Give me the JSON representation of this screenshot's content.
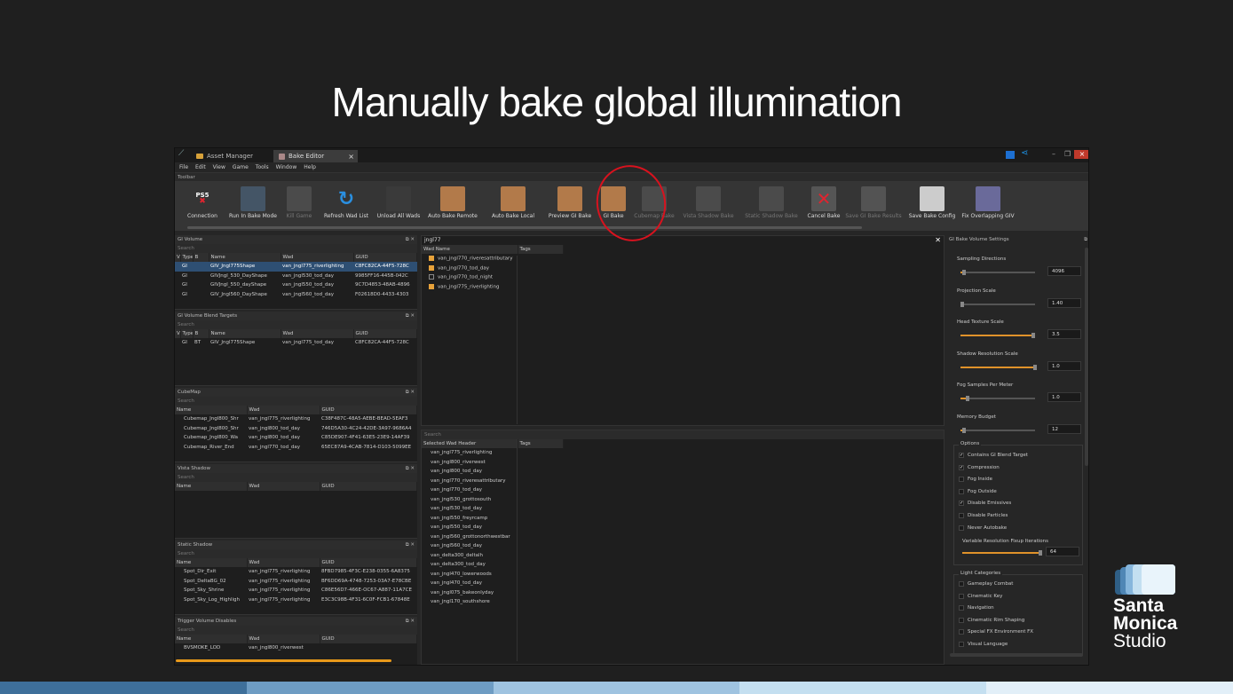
{
  "slide": {
    "title": "Manually bake global illumination"
  },
  "app": {
    "tabs": [
      "Asset Manager",
      "Bake Editor"
    ],
    "menu": [
      "File",
      "Edit",
      "View",
      "Game",
      "Tools",
      "Window",
      "Help"
    ],
    "toolbar_label": "Toolbar",
    "toolbar_buttons": [
      {
        "label": "Connection",
        "icon": "ps5-icon",
        "enabled": true
      },
      {
        "label": "Run In Bake Mode",
        "icon": "run-bake-icon",
        "enabled": true
      },
      {
        "label": "Kill Game",
        "icon": "kill-game-icon",
        "enabled": false
      },
      {
        "label": "Refresh Wad List",
        "icon": "refresh-icon",
        "enabled": true
      },
      {
        "label": "Unload All Wads",
        "icon": "unload-wads-icon",
        "enabled": true
      },
      {
        "label": "Auto Bake Remote",
        "icon": "auto-bake-remote-icon",
        "enabled": true
      },
      {
        "label": "Auto Bake Local",
        "icon": "auto-bake-local-icon",
        "enabled": true
      },
      {
        "label": "Preview GI Bake",
        "icon": "preview-gi-icon",
        "enabled": true
      },
      {
        "label": "GI Bake",
        "icon": "gi-bake-icon",
        "enabled": true
      },
      {
        "label": "Cubemap Bake",
        "icon": "cubemap-bake-icon",
        "enabled": false
      },
      {
        "label": "Vista Shadow Bake",
        "icon": "vista-shadow-icon",
        "enabled": false
      },
      {
        "label": "Static Shadow Bake",
        "icon": "static-shadow-icon",
        "enabled": false
      },
      {
        "label": "Cancel Bake",
        "icon": "cancel-bake-icon",
        "enabled": true
      },
      {
        "label": "Save GI Bake Results",
        "icon": "save-gi-icon",
        "enabled": false
      },
      {
        "label": "Save Bake Config",
        "icon": "save-config-icon",
        "enabled": true
      },
      {
        "label": "Fix Overlapping GIV",
        "icon": "fix-overlap-icon",
        "enabled": true
      }
    ]
  },
  "gi_volume": {
    "title": "GI Volume",
    "search": "Search",
    "headers": [
      "V",
      "Type",
      "B",
      "Name",
      "Wad",
      "GUID"
    ],
    "rows": [
      [
        "",
        "GI",
        "",
        "GIV_Jngl775Shape",
        "van_jngl775_riverlighting",
        "C8FC82CA-44F5-728C"
      ],
      [
        "",
        "GI",
        "",
        "GIVJngl_530_DayShape",
        "van_jngl530_tod_day",
        "9985FF16-445B-042C"
      ],
      [
        "",
        "GI",
        "",
        "GIVJngl_550_dayShape",
        "van_jngl550_tod_day",
        "9C7D4853-48AB-4896"
      ],
      [
        "",
        "GI",
        "",
        "GIV_Jngl560_DayShape",
        "van_jngl560_tod_day",
        "F02618D0-4433-4303"
      ]
    ]
  },
  "gi_blend": {
    "title": "GI Volume Blend Targets",
    "search": "Search",
    "headers": [
      "V",
      "Type",
      "B",
      "Name",
      "Wad",
      "GUID"
    ],
    "rows": [
      [
        "",
        "GI",
        "BT",
        "GIV_Jngl775Shape",
        "van_jngl775_tod_day",
        "C8FC82CA-44F5-728C"
      ]
    ]
  },
  "cubemap": {
    "title": "CubeMap",
    "search": "Search",
    "headers": [
      "Name",
      "Wad",
      "GUID"
    ],
    "rows": [
      [
        "Cubemap_Jngl800_Shr",
        "van_jngl775_riverlighting",
        "C38F487C-48A5-AEBE-BEAD-5EAF3"
      ],
      [
        "Cubemap_Jngl800_Shr",
        "van_jngl800_tod_day",
        "746D5A30-4C24-42DE-3A97-9686A4"
      ],
      [
        "Cubemap_Jngl800_Wa",
        "van_jngl800_tod_day",
        "C85DE907-4F41-63E5-23E9-14AF39"
      ],
      [
        "Cubemap_River_End",
        "van_jngl770_tod_day",
        "65EC87A9-4CAB-7814-D103-5099EE"
      ]
    ]
  },
  "vista_shadow": {
    "title": "Vista Shadow",
    "search": "Search",
    "headers": [
      "Name",
      "Wad",
      "GUID"
    ]
  },
  "static_shadow": {
    "title": "Static Shadow",
    "search": "Search",
    "headers": [
      "Name",
      "Wad",
      "GUID"
    ],
    "rows": [
      [
        "Spot_Dir_Exit",
        "van_jngl775_riverlighting",
        "8FBD7985-4F3C-E238-0355-6A8375"
      ],
      [
        "Spot_DeltaBG_02",
        "van_jngl775_riverlighting",
        "BF6DD69A-4748-7253-03A7-E78CBE"
      ],
      [
        "Spot_Sky_Shrine",
        "van_jngl775_riverlighting",
        "C86E56D7-466E-OC67-A887-11A7CE"
      ],
      [
        "Spot_Sky_Log_Highligh",
        "van_jngl775_riverlighting",
        "E3C3C98B-4F31-6C0F-FCB1-67848E"
      ]
    ]
  },
  "trigger_volume": {
    "title": "Trigger Volume Disables",
    "search": "Search",
    "headers": [
      "Name",
      "Wad",
      "GUID"
    ],
    "rows": [
      [
        "BVSMOKE_LOD",
        "van_jngl800_riverwest",
        ""
      ]
    ]
  },
  "wad_panel": {
    "title": "jngl77",
    "headers": [
      "Wad Name",
      "Tags"
    ],
    "rows": [
      {
        "name": "van_jngl770_riveresattributary",
        "checked": true
      },
      {
        "name": "van_jngl770_tod_day",
        "checked": true
      },
      {
        "name": "van_jngl770_tod_night",
        "checked": false
      },
      {
        "name": "van_jngl775_riverlighting",
        "checked": true
      }
    ]
  },
  "selected_wad": {
    "search": "Search",
    "headers": [
      "Selected Wad Header",
      "Tags"
    ],
    "rows": [
      "van_jngl775_riverlighting",
      "van_jngl800_riverwest",
      "van_jngl800_tod_day",
      "van_jngl770_riveresattributary",
      "van_jngl770_tod_day",
      "van_jngl530_grottosouth",
      "van_jngl530_tod_day",
      "van_jngl550_freyrcamp",
      "van_jngl550_tod_day",
      "van_jngl560_grottonorthwestbar",
      "van_jngl560_tod_day",
      "van_delta300_deltalh",
      "van_delta300_tod_day",
      "van_jngl470_lowerwoods",
      "van_jngl470_tod_day",
      "van_jngl075_bakeonlyday",
      "van_jngl170_southshore"
    ]
  },
  "settings": {
    "title": "GI Bake Volume Settings",
    "fields": [
      {
        "label": "Sampling Directions",
        "value": "4096",
        "level": 0.05
      },
      {
        "label": "Projection Scale",
        "value": "1.40",
        "level": 0.02
      },
      {
        "label": "Head Texture Scale",
        "value": "3.5",
        "level": 0.98
      },
      {
        "label": "Shadow Resolution Scale",
        "value": "1.0",
        "level": 1.0
      },
      {
        "label": "Fog Samples Per Meter",
        "value": "1.0",
        "level": 0.1
      },
      {
        "label": "Memory Budget",
        "value": "12",
        "level": 0.05
      }
    ],
    "options_label": "Options",
    "options": [
      {
        "label": "Contains GI Blend Target",
        "checked": true
      },
      {
        "label": "Compression",
        "checked": true
      },
      {
        "label": "Fog Inside",
        "checked": false
      },
      {
        "label": "Fog Outside",
        "checked": false
      },
      {
        "label": "Disable Emissives",
        "checked": true
      },
      {
        "label": "Disable Particles",
        "checked": false
      },
      {
        "label": "Never Autobake",
        "checked": false
      }
    ],
    "variable_res": {
      "label": "Variable Resolution Fixup Iterations",
      "value": "64",
      "level": 0.98
    },
    "light_categories_label": "Light Categories",
    "light_categories": [
      {
        "label": "Gameplay Combat",
        "checked": false
      },
      {
        "label": "Cinematic Key",
        "checked": false
      },
      {
        "label": "Navigation",
        "checked": false
      },
      {
        "label": "Cinematic Rim Shaping",
        "checked": false
      },
      {
        "label": "Special FX Environment FX",
        "checked": false
      },
      {
        "label": "Visual Language",
        "checked": false
      }
    ]
  },
  "logo": {
    "line1": "Santa",
    "line2": "Monica",
    "line3": "Studio"
  },
  "colors": {
    "accent_orange": "#e8991a",
    "highlight_red": "#d8121e",
    "selection_blue": "#2e4f73",
    "footer": [
      "#3e6f9a",
      "#6e9cc3",
      "#9fc3e0",
      "#c4dff0",
      "#e2eff8"
    ]
  }
}
